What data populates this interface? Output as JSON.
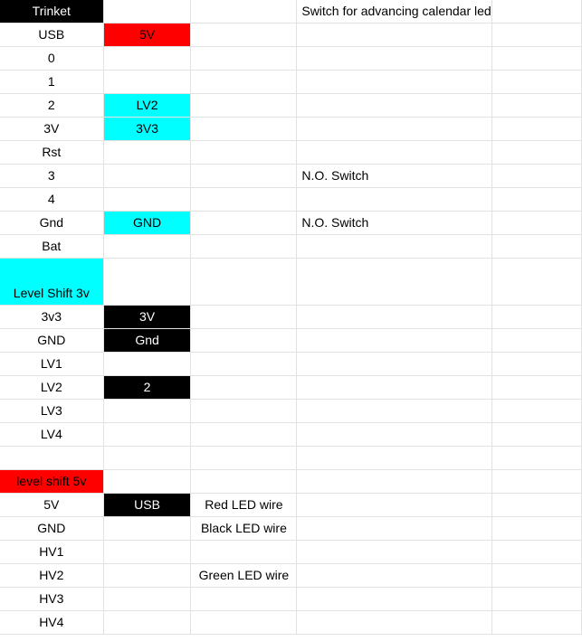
{
  "colors": {
    "black": "#000000",
    "red": "#ff0000",
    "cyan": "#00ffff",
    "grid": "#e2e2e2"
  },
  "rows": [
    {
      "c1": "Trinket",
      "c2": "",
      "c3": "",
      "c4": "Switch for advancing calendar led",
      "c1_style": "black",
      "c2_style": ""
    },
    {
      "c1": "USB",
      "c2": "5V",
      "c3": "",
      "c4": "",
      "c1_style": "",
      "c2_style": "red"
    },
    {
      "c1": "0",
      "c2": "",
      "c3": "",
      "c4": "",
      "c1_style": "",
      "c2_style": ""
    },
    {
      "c1": "1",
      "c2": "",
      "c3": "",
      "c4": "",
      "c1_style": "",
      "c2_style": ""
    },
    {
      "c1": "2",
      "c2": "LV2",
      "c3": "",
      "c4": "",
      "c1_style": "",
      "c2_style": "cyan"
    },
    {
      "c1": "3V",
      "c2": "3V3",
      "c3": "",
      "c4": "",
      "c1_style": "",
      "c2_style": "cyan"
    },
    {
      "c1": "Rst",
      "c2": "",
      "c3": "",
      "c4": "",
      "c1_style": "",
      "c2_style": ""
    },
    {
      "c1": "3",
      "c2": "",
      "c3": "",
      "c4": "N.O. Switch",
      "c1_style": "",
      "c2_style": ""
    },
    {
      "c1": "4",
      "c2": "",
      "c3": "",
      "c4": "",
      "c1_style": "",
      "c2_style": ""
    },
    {
      "c1": "Gnd",
      "c2": "GND",
      "c3": "",
      "c4": "N.O. Switch",
      "c1_style": "",
      "c2_style": "cyan"
    },
    {
      "c1": "Bat",
      "c2": "",
      "c3": "",
      "c4": "",
      "c1_style": "",
      "c2_style": ""
    },
    {
      "c1": "Level Shift 3v",
      "c2": "",
      "c3": "",
      "c4": "",
      "c1_style": "cyan",
      "c2_style": "",
      "tall": true
    },
    {
      "c1": "3v3",
      "c2": "3V",
      "c3": "",
      "c4": "",
      "c1_style": "",
      "c2_style": "black"
    },
    {
      "c1": "GND",
      "c2": "Gnd",
      "c3": "",
      "c4": "",
      "c1_style": "",
      "c2_style": "black"
    },
    {
      "c1": "LV1",
      "c2": "",
      "c3": "",
      "c4": "",
      "c1_style": "",
      "c2_style": ""
    },
    {
      "c1": "LV2",
      "c2": "2",
      "c3": "",
      "c4": "",
      "c1_style": "",
      "c2_style": "black"
    },
    {
      "c1": "LV3",
      "c2": "",
      "c3": "",
      "c4": "",
      "c1_style": "",
      "c2_style": ""
    },
    {
      "c1": "LV4",
      "c2": "",
      "c3": "",
      "c4": "",
      "c1_style": "",
      "c2_style": ""
    },
    {
      "c1": "",
      "c2": "",
      "c3": "",
      "c4": "",
      "c1_style": "",
      "c2_style": ""
    },
    {
      "c1": "level shift 5v",
      "c2": "",
      "c3": "",
      "c4": "",
      "c1_style": "red",
      "c2_style": ""
    },
    {
      "c1": "5V",
      "c2": "USB",
      "c3": "Red LED wire",
      "c4": "",
      "c1_style": "",
      "c2_style": "black"
    },
    {
      "c1": "GND",
      "c2": "",
      "c3": "Black LED wire",
      "c4": "",
      "c1_style": "",
      "c2_style": ""
    },
    {
      "c1": "HV1",
      "c2": "",
      "c3": "",
      "c4": "",
      "c1_style": "",
      "c2_style": ""
    },
    {
      "c1": "HV2",
      "c2": "",
      "c3": "Green LED wire",
      "c4": "",
      "c1_style": "",
      "c2_style": ""
    },
    {
      "c1": "HV3",
      "c2": "",
      "c3": "",
      "c4": "",
      "c1_style": "",
      "c2_style": ""
    },
    {
      "c1": "HV4",
      "c2": "",
      "c3": "",
      "c4": "",
      "c1_style": "",
      "c2_style": ""
    }
  ]
}
